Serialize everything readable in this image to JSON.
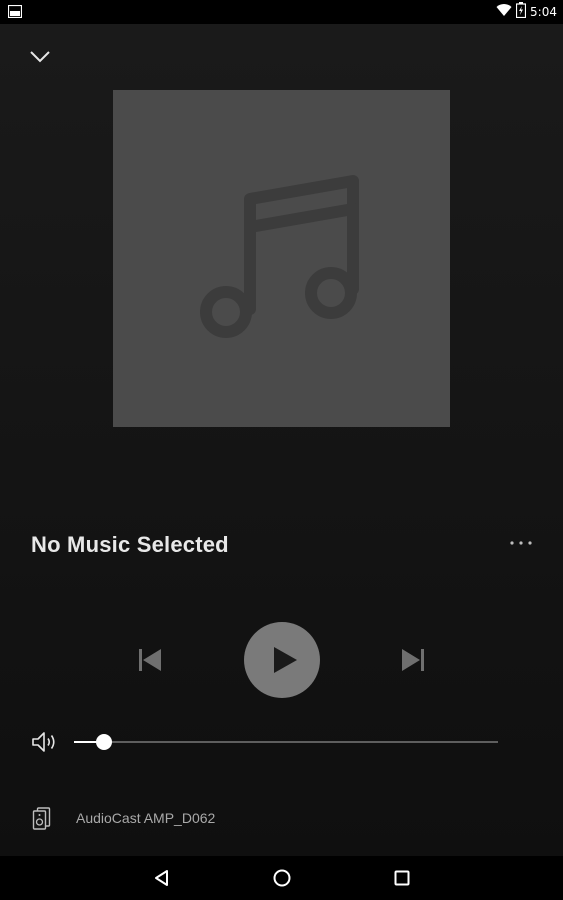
{
  "status_bar": {
    "time": "5:04",
    "icons": [
      "image-notification-icon",
      "wifi-icon",
      "battery-charging-icon"
    ]
  },
  "header": {
    "collapse_icon": "chevron-down-icon"
  },
  "album_art": {
    "placeholder_icon": "music-note-icon"
  },
  "track": {
    "title": "No Music Selected"
  },
  "more_menu_icon": "more-horizontal-icon",
  "controls": {
    "previous_icon": "skip-previous-icon",
    "play_icon": "play-icon",
    "next_icon": "skip-next-icon"
  },
  "volume": {
    "icon": "volume-icon",
    "level": 0.07
  },
  "output_device": {
    "icon": "speaker-device-icon",
    "name": "AudioCast AMP_D062"
  },
  "nav_bar": {
    "icons": [
      "back-icon",
      "home-icon",
      "recents-icon"
    ]
  },
  "colors": {
    "background": "#141414",
    "album_placeholder": "#4b4b4b",
    "play_button": "#7a7a7a",
    "accent": "#ffffff"
  }
}
